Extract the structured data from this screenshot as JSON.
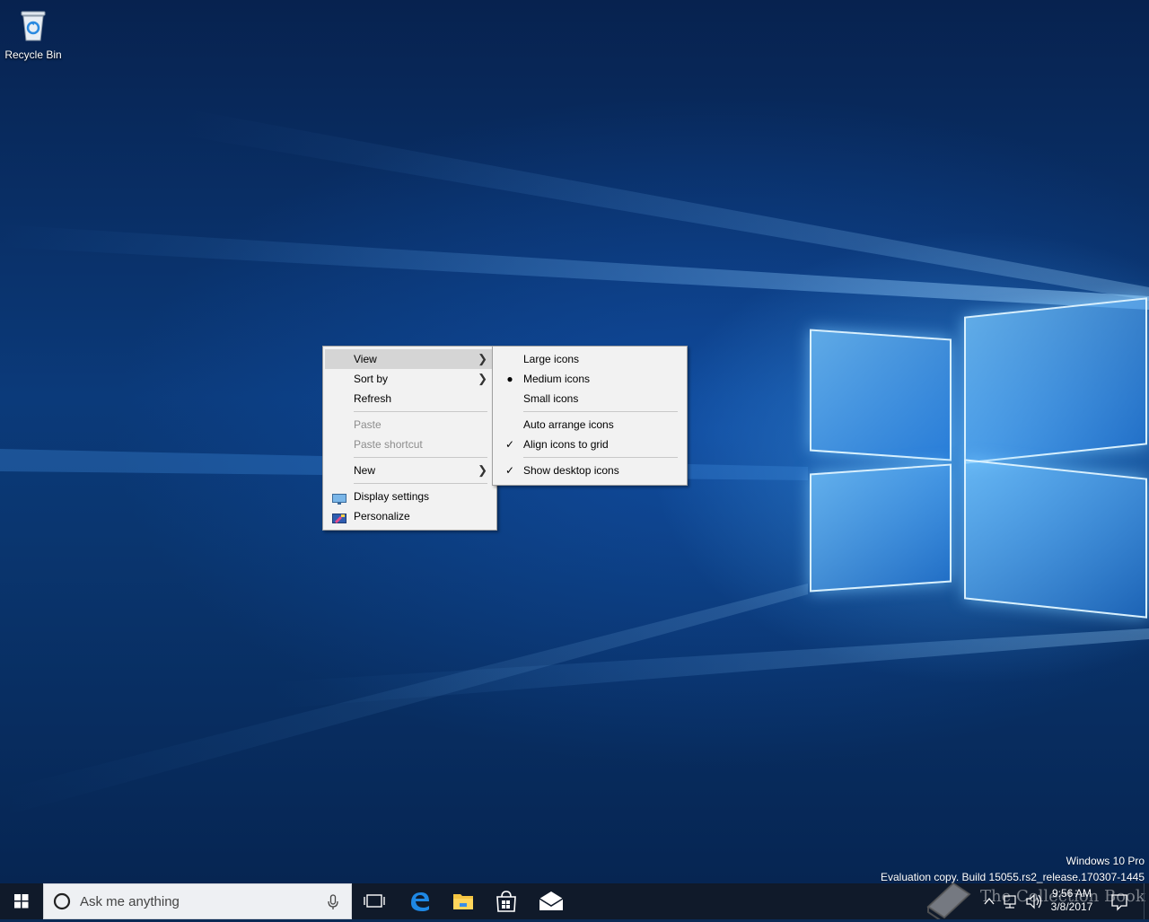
{
  "desktop": {
    "recycle_bin_label": "Recycle Bin",
    "watermark_line1": "Windows 10 Pro",
    "watermark_line2": "Evaluation copy. Build 15055.rs2_release.170307-1445"
  },
  "context_menu": {
    "items": [
      {
        "label": "View",
        "state": "hover",
        "submenu": true
      },
      {
        "label": "Sort by",
        "submenu": true
      },
      {
        "label": "Refresh"
      },
      {
        "label": "Paste",
        "state": "disabled"
      },
      {
        "label": "Paste shortcut",
        "state": "disabled"
      },
      {
        "label": "New",
        "submenu": true
      },
      {
        "label": "Display settings",
        "icon": "display-settings-icon"
      },
      {
        "label": "Personalize",
        "icon": "personalize-icon"
      }
    ]
  },
  "view_submenu": {
    "items": [
      {
        "label": "Large icons",
        "mark": ""
      },
      {
        "label": "Medium icons",
        "mark": "bullet"
      },
      {
        "label": "Small icons",
        "mark": ""
      },
      {
        "label": "Auto arrange icons",
        "mark": ""
      },
      {
        "label": "Align icons to grid",
        "mark": "check"
      },
      {
        "label": "Show desktop icons",
        "mark": "check"
      }
    ]
  },
  "taskbar": {
    "search_placeholder": "Ask me anything",
    "apps": [
      "task-view-icon",
      "edge-icon",
      "file-explorer-icon",
      "store-icon",
      "mail-icon"
    ],
    "clock_time": "9:56 AM",
    "clock_date": "3/8/2017",
    "overlay_text": "The Collection Book"
  },
  "colors": {
    "menu_bg": "#f2f2f2",
    "menu_hover": "#d5d5d5",
    "taskbar_bg": "#101a2a",
    "accent": "#0078d7"
  }
}
